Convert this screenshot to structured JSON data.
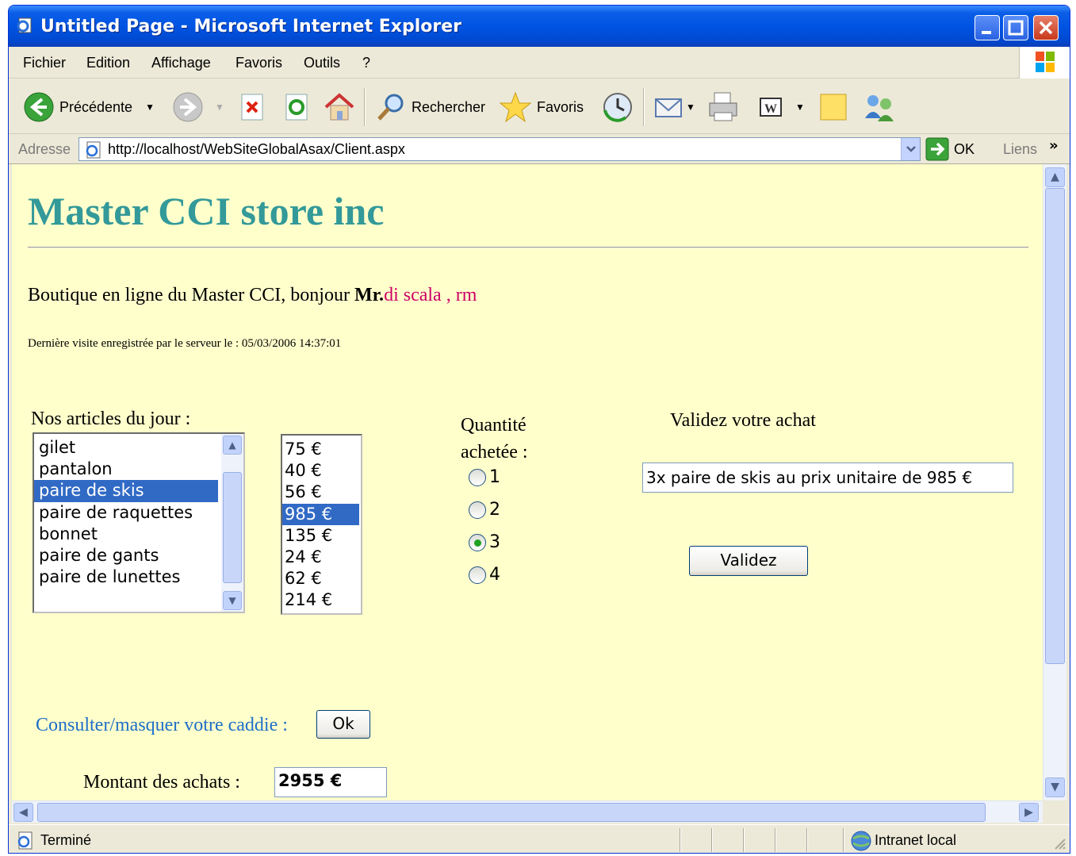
{
  "window": {
    "title": "Untitled Page - Microsoft Internet Explorer"
  },
  "menu": {
    "items": [
      "Fichier",
      "Edition",
      "Affichage",
      "Favoris",
      "Outils",
      "?"
    ]
  },
  "toolbar": {
    "back_label": "Précédente",
    "search_label": "Rechercher",
    "favorites_label": "Favoris"
  },
  "address": {
    "label": "Adresse",
    "url": "http://localhost/WebSiteGlobalAsax/Client.aspx",
    "go_label": "OK",
    "links_label": "Liens"
  },
  "page": {
    "title": "Master CCI store inc",
    "greeting_prefix": "Boutique en ligne du Master CCI, bonjour ",
    "greeting_mr": "Mr.",
    "greeting_name": "di scala ,  rm",
    "last_visit": "Dernière visite enregistrée par le serveur le : 05/03/2006 14:37:01",
    "articles_label": "Nos articles du jour :",
    "articles": [
      {
        "label": "gilet",
        "selected": false
      },
      {
        "label": "pantalon",
        "selected": false
      },
      {
        "label": "paire de skis",
        "selected": true
      },
      {
        "label": "paire de raquettes",
        "selected": false
      },
      {
        "label": "bonnet",
        "selected": false
      },
      {
        "label": "paire de gants",
        "selected": false
      },
      {
        "label": "paire de lunettes",
        "selected": false
      }
    ],
    "prices": [
      {
        "label": "75 €",
        "selected": false
      },
      {
        "label": "40 €",
        "selected": false
      },
      {
        "label": "56 €",
        "selected": false
      },
      {
        "label": "985 €",
        "selected": true
      },
      {
        "label": "135 €",
        "selected": false
      },
      {
        "label": "24 €",
        "selected": false
      },
      {
        "label": "62 €",
        "selected": false
      },
      {
        "label": "214 €",
        "selected": false
      }
    ],
    "qty_label_line1": "Quantité",
    "qty_label_line2": "achetée :",
    "quantities": [
      {
        "label": "1",
        "checked": false
      },
      {
        "label": "2",
        "checked": false
      },
      {
        "label": "3",
        "checked": true
      },
      {
        "label": "4",
        "checked": false
      }
    ],
    "validate_label": "Validez votre achat",
    "purchase_summary": "3x paire de skis au prix unitaire de 985 €",
    "validate_button": "Validez",
    "cart_label": "Consulter/masquer votre caddie :",
    "cart_button": "Ok",
    "amount_label": "Montant des achats :",
    "amount_value": "2955 €"
  },
  "status": {
    "text": "Terminé",
    "zone": "Intranet local"
  }
}
